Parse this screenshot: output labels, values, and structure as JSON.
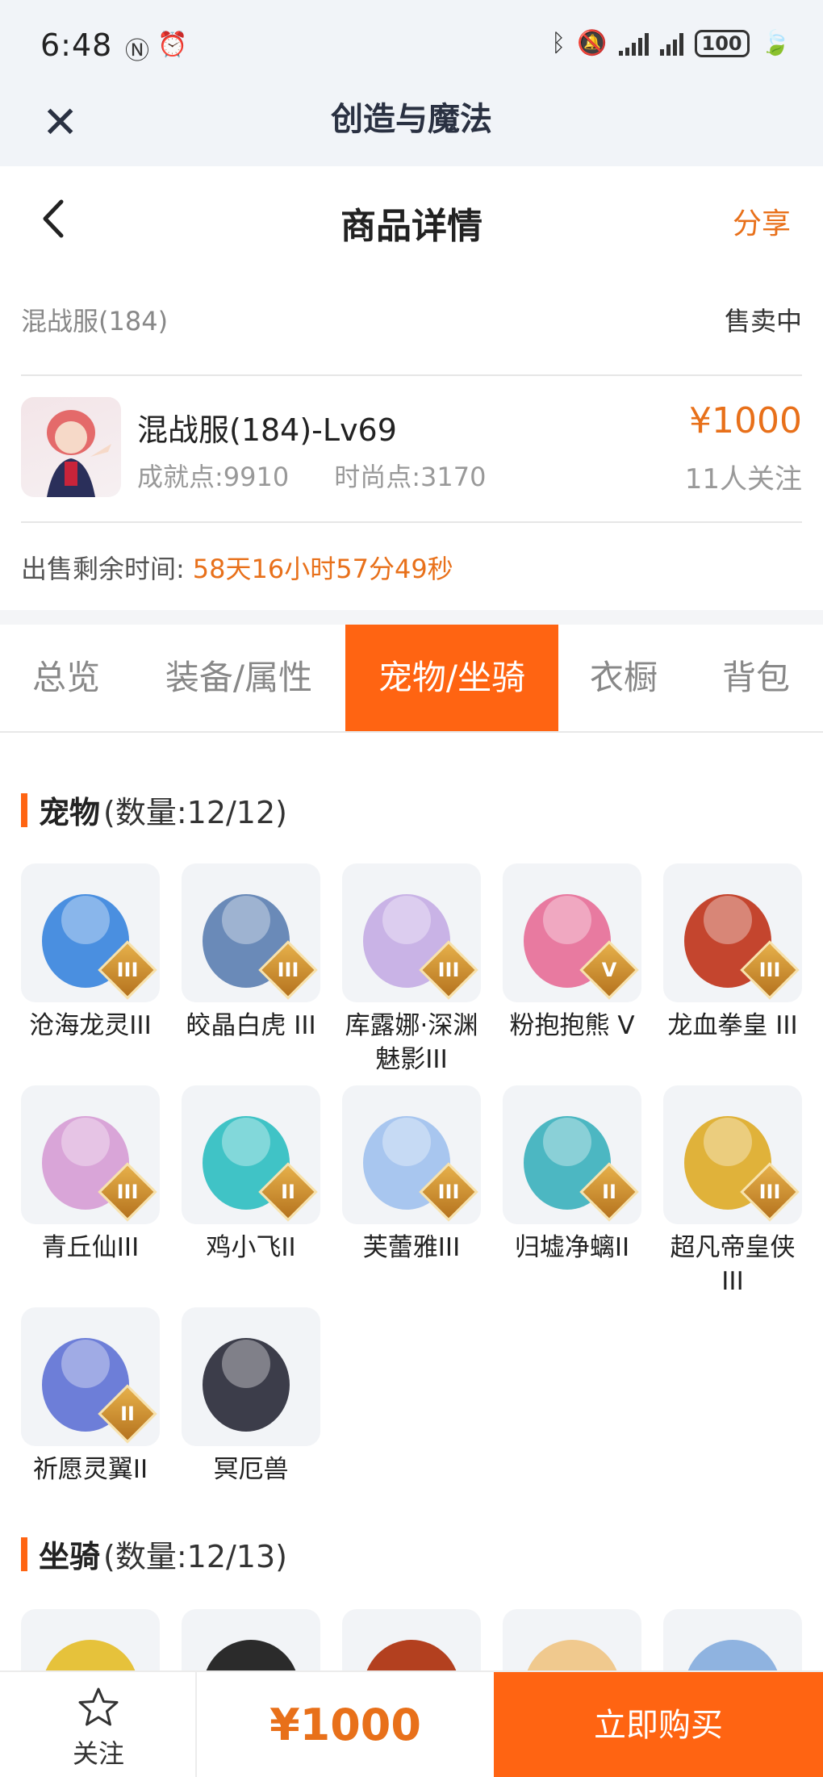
{
  "status_bar": {
    "time": "6:48",
    "battery": "100"
  },
  "app": {
    "title": "创造与魔法"
  },
  "header": {
    "title": "商品详情",
    "share_label": "分享"
  },
  "listing": {
    "server": "混战服(184)",
    "status": "售卖中",
    "character_name": "混战服(184)-Lv69",
    "achievement": "成就点:9910",
    "fashion": "时尚点:3170",
    "price": "¥1000",
    "followers": "11人关注",
    "remaining_label": "出售剩余时间:",
    "remaining_value": "58天16小时57分49秒"
  },
  "tabs": [
    {
      "label": "总览",
      "active": false
    },
    {
      "label": "装备/属性",
      "active": false
    },
    {
      "label": "宠物/坐骑",
      "active": true
    },
    {
      "label": "衣橱",
      "active": false
    },
    {
      "label": "背包",
      "active": false
    }
  ],
  "pets": {
    "title": "宠物",
    "count": "(数量:12/12)",
    "items": [
      {
        "name": "沧海龙灵III",
        "tier": "III",
        "color": "#4a8fe0"
      },
      {
        "name": "皎晶白虎 III",
        "tier": "III",
        "color": "#6a8ab8"
      },
      {
        "name": "库露娜·深渊魅影III",
        "tier": "III",
        "color": "#c9b3e6"
      },
      {
        "name": "粉抱抱熊 V",
        "tier": "V",
        "color": "#e87aa0"
      },
      {
        "name": "龙血拳皇 III",
        "tier": "III",
        "color": "#c4452e"
      },
      {
        "name": "青丘仙III",
        "tier": "III",
        "color": "#d9a5d8"
      },
      {
        "name": "鸡小飞II",
        "tier": "II",
        "color": "#40c3c6"
      },
      {
        "name": "芙蕾雅III",
        "tier": "III",
        "color": "#a8c6ef"
      },
      {
        "name": "归墟净螭II",
        "tier": "II",
        "color": "#4cb7c2"
      },
      {
        "name": "超凡帝皇侠III",
        "tier": "III",
        "color": "#e0b23a"
      },
      {
        "name": "祈愿灵翼II",
        "tier": "II",
        "color": "#6d7ed8"
      },
      {
        "name": "冥厄兽",
        "tier": "",
        "color": "#3c3d4a"
      }
    ]
  },
  "mounts": {
    "title": "坐骑",
    "count": "(数量:12/13)",
    "colors": [
      "#e6c23b",
      "#2b2b2b",
      "#b3401f",
      "#f0c98e",
      "#8fb3e0"
    ]
  },
  "bottom": {
    "follow_label": "关注",
    "price": "¥1000",
    "buy_label": "立即购买"
  }
}
